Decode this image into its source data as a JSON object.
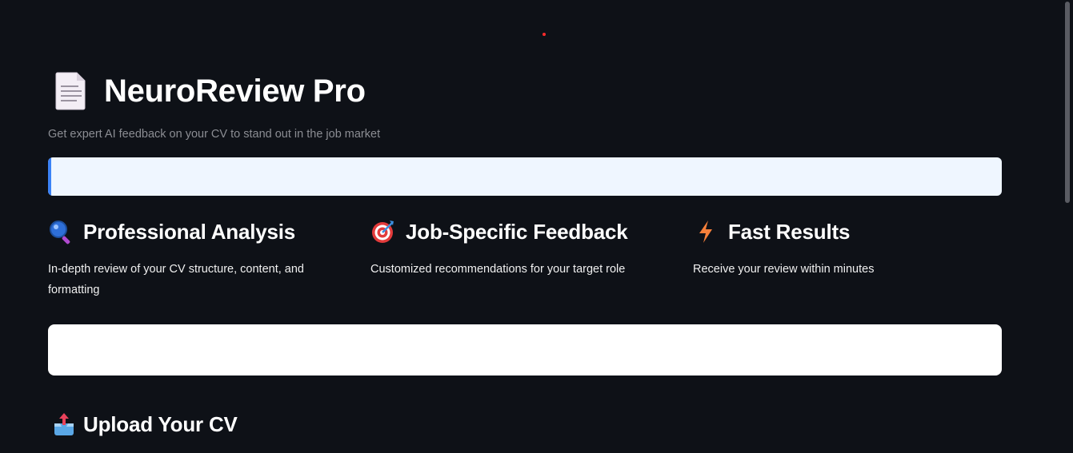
{
  "header": {
    "title": "NeuroReview Pro",
    "subtitle": "Get expert AI feedback on your CV to stand out in the job market",
    "icon": "page-facing-up-icon"
  },
  "features": [
    {
      "icon": "magnifier-icon",
      "title": "Professional Analysis",
      "description": "In-depth review of your CV structure, content, and formatting"
    },
    {
      "icon": "target-icon",
      "title": "Job-Specific Feedback",
      "description": "Customized recommendations for your target role"
    },
    {
      "icon": "lightning-icon",
      "title": "Fast Results",
      "description": "Receive your review within minutes"
    }
  ],
  "upload": {
    "icon": "outbox-tray-icon",
    "title": "Upload Your CV"
  },
  "colors": {
    "background": "#0e1117",
    "info_bar": "#eff6ff",
    "info_accent": "#3b82f6",
    "status_dot": "#ff2b2b"
  }
}
